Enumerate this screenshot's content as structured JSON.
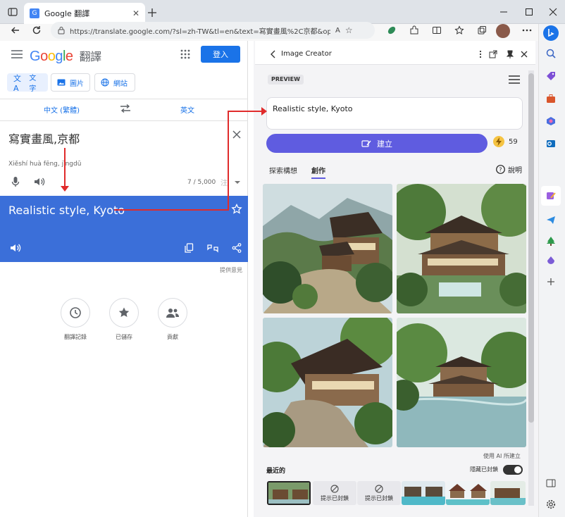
{
  "browser": {
    "tab_title": "Google 翻譯",
    "url": "https://translate.google.com/?sl=zh-TW&tl=en&text=寫實畫風%2C京都&op=transl..."
  },
  "translate": {
    "logo_google": "Google",
    "logo_product": "翻譯",
    "signin": "登入",
    "mode_tabs": [
      "文字",
      "圖片",
      "網站"
    ],
    "source_lang": "中文 (繁體)",
    "target_lang": "英文",
    "source_text": "寫實畫風,京都",
    "transliteration": "Xiěshí huà fēng, jīngdū",
    "char_count": "7 / 5,000",
    "output_text": "Realistic style, Kyoto",
    "feedback": "提供意見",
    "actions": [
      "翻譯記錄",
      "已儲存",
      "貢獻"
    ]
  },
  "image_creator": {
    "title": "Image Creator",
    "preview_badge": "PREVIEW",
    "prompt": "Realistic style, Kyoto",
    "create_button": "建立",
    "boosts": "59",
    "tabs": [
      "探索構想",
      "創作"
    ],
    "help": "說明",
    "ai_note": "使用 AI 所建立",
    "recent_label": "最近的",
    "hide_blocked": "隱藏已封鎖",
    "blocked_thumb_text": "提示已封鎖"
  },
  "colors": {
    "google_blue": "#1a73e8",
    "output_bg": "#3b6fd9",
    "create_button": "#5f5ce0",
    "arrow": "#e02b2b"
  }
}
